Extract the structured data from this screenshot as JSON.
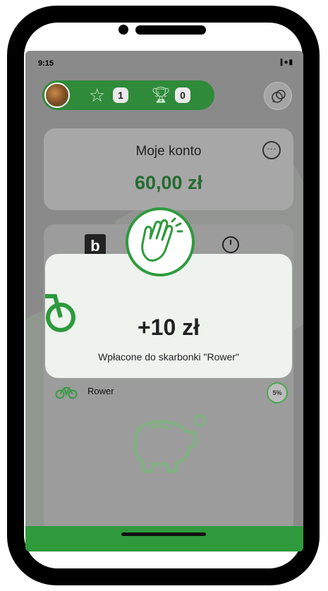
{
  "status_bar": {
    "time": "9:15",
    "icons": "∥●▮"
  },
  "profile": {
    "stars": "1",
    "trophies": "0"
  },
  "account": {
    "title": "Moje konto",
    "amount": "60,00 zł"
  },
  "card": {
    "logo_letter": "b"
  },
  "goal": {
    "name": "Rower",
    "progress": "5%"
  },
  "toast": {
    "amount": "+10 zł",
    "message": "Wpłacone do skarbonki \"Rower\""
  },
  "colors": {
    "brand_green": "#2f9a3c",
    "amount_green": "#246b2f"
  },
  "icons": {
    "star": "star-icon",
    "trophy": "trophy-icon",
    "chat": "chat-icon",
    "more": "more-icon",
    "history": "history-icon",
    "bike": "bike-icon",
    "piggy": "piggy-bank-icon",
    "clap": "clapping-hands-icon"
  }
}
